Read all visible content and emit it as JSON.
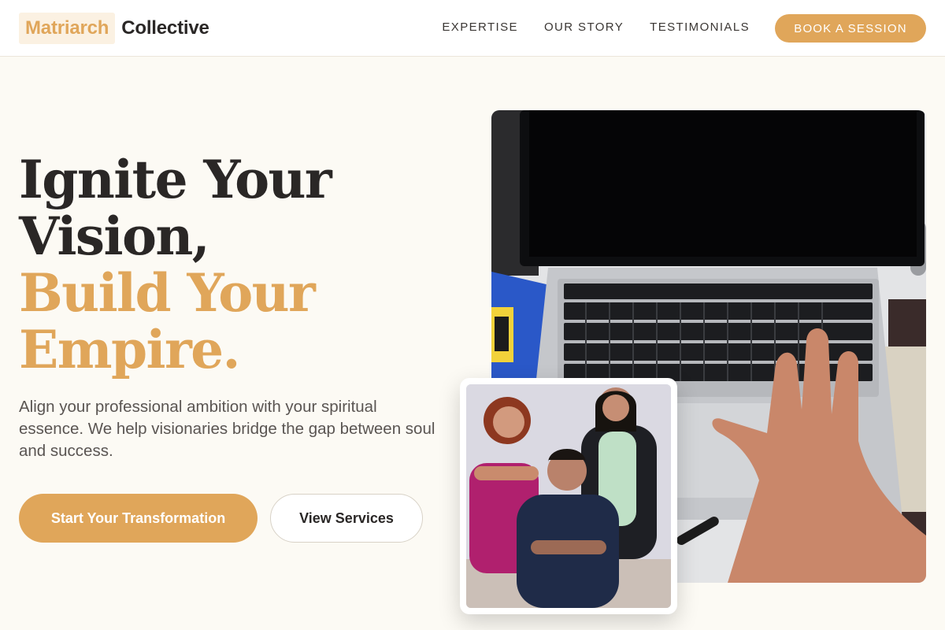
{
  "brand": {
    "accent": "Matriarch",
    "name": "Collective"
  },
  "nav": {
    "links": [
      "EXPERTISE",
      "OUR STORY",
      "TESTIMONIALS"
    ],
    "cta": "BOOK A SESSION"
  },
  "hero": {
    "headline_lines": [
      "Ignite Your",
      "Vision,",
      "Build Your",
      "Empire."
    ],
    "lead": "Align your professional ambition with your spiritual essence. We help visionaries bridge the gap between soul and success.",
    "primary_button": "Start Your Transformation",
    "secondary_button": "View Services"
  },
  "images": {
    "hero_photo": "laptop-with-hand-photo",
    "team_photo": "team-of-three-photo"
  },
  "colors": {
    "accent": "#e0a65a",
    "accent_tint": "#fbf1e2",
    "page_bg": "#fcfaf4",
    "text_dark": "#2a2726",
    "text_body": "#5a5552"
  }
}
